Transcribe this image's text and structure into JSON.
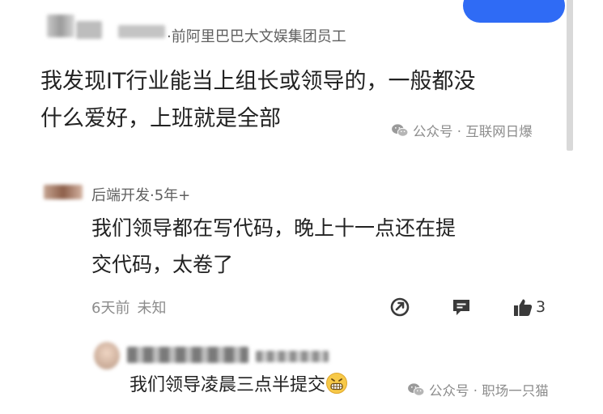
{
  "top_comment": {
    "author_meta": "·前阿里巴巴大文娱集团员工",
    "text_line1": "我发现IT行业能当上组长或领导的，一般都没",
    "text_line2": "什么爱好，上班就是全部",
    "watermark": "公众号 · 互联网日爆"
  },
  "reply": {
    "author_meta": "后端开发·5年+",
    "text_line1": "我们领导都在写代码，晚上十一点还在提",
    "text_line2": "交代码，太卷了",
    "time": "6天前",
    "status": "未知",
    "like_count": "3"
  },
  "sub_reply": {
    "text": "我们领导凌晨三点半提交",
    "watermark": "公众号 · 职场一只猫"
  },
  "icons": {
    "share": "share-icon",
    "comment": "comment-icon",
    "like": "thumbs-up-icon",
    "wechat": "wechat-icon",
    "emoji": "grinning-face-icon"
  },
  "colors": {
    "accent": "#2f6bf5",
    "muted": "#8c8c8c"
  }
}
